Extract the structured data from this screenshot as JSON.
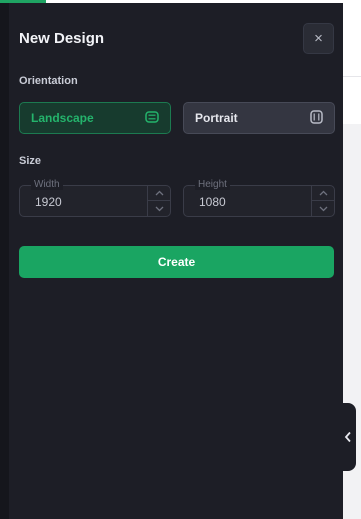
{
  "dialog": {
    "title": "New Design",
    "close_glyph": "×",
    "close_icon": "close-icon"
  },
  "orientation": {
    "label": "Orientation",
    "selected": "Landscape",
    "options": [
      {
        "label": "Landscape",
        "icon": "landscape-screen-icon",
        "selected": true
      },
      {
        "label": "Portrait",
        "icon": "portrait-screen-icon",
        "selected": false
      }
    ]
  },
  "size": {
    "label": "Size",
    "width": {
      "label": "Width",
      "value": "1920"
    },
    "height": {
      "label": "Height",
      "value": "1080"
    }
  },
  "create_label": "Create",
  "collapse_icon": "chevron-left-icon",
  "colors": {
    "panel_bg": "#1d1e26",
    "accent": "#1aa562",
    "selected_text": "#24b46c"
  }
}
